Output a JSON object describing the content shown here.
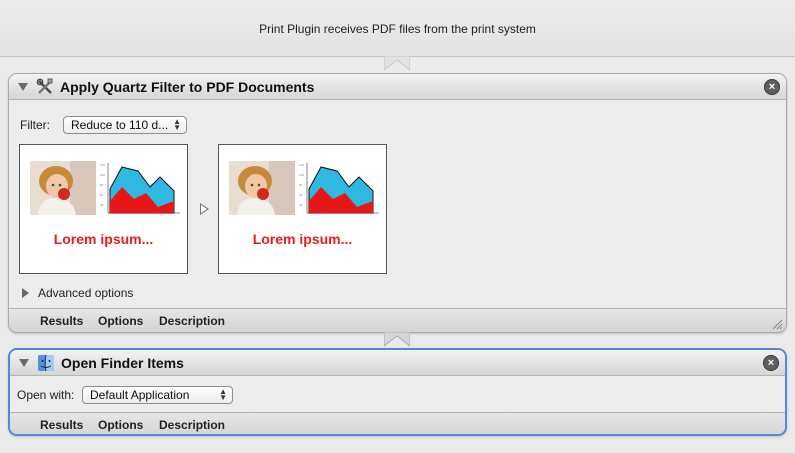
{
  "workflow_input": {
    "text": "Print Plugin receives PDF files from the print system"
  },
  "actions": [
    {
      "title": "Apply Quartz Filter to PDF Documents",
      "icon": "quartz-filter-tools-icon",
      "filter_label": "Filter:",
      "filter_value": "Reduce to 110 d...",
      "preview_text_before": "Lorem ipsum...",
      "preview_text_after": "Lorem ipsum...",
      "advanced_label": "Advanced options",
      "tabs": [
        "Results",
        "Options",
        "Description"
      ]
    },
    {
      "title": "Open Finder Items",
      "icon": "finder-icon",
      "open_with_label": "Open with:",
      "open_with_value": "Default Application",
      "tabs": [
        "Results",
        "Options",
        "Description"
      ]
    }
  ],
  "colors": {
    "selection_border": "#5a86d6",
    "preview_text": "#e41e1e",
    "chart_cyan": "#2fb8e0",
    "chart_red": "#e81616"
  }
}
